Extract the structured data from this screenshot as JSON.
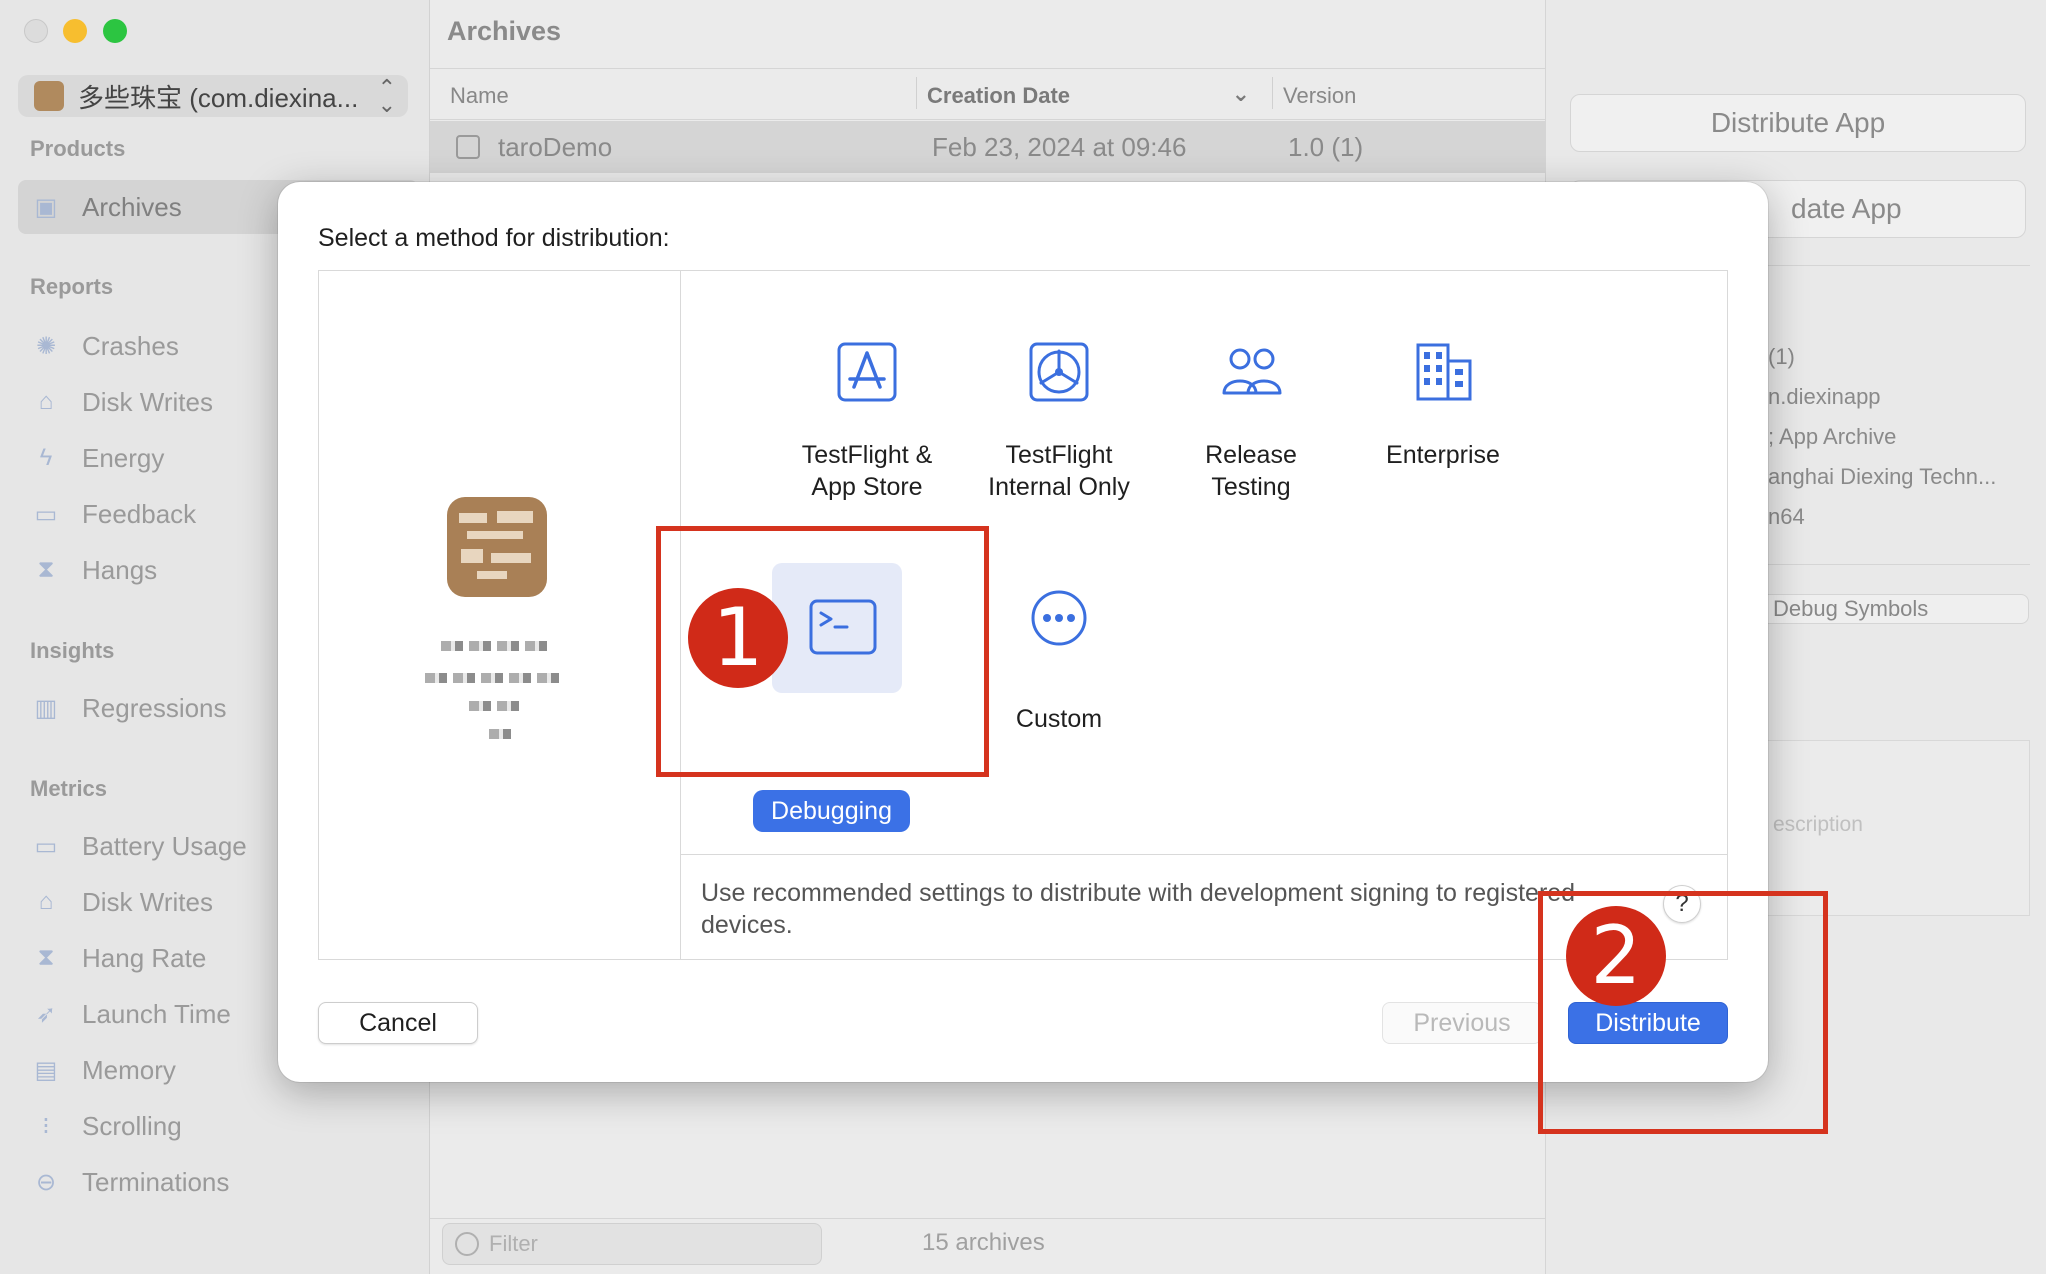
{
  "sidebar": {
    "app_selector": "多些珠宝 (com.diexina...",
    "sections": {
      "products": "Products",
      "reports": "Reports",
      "insights": "Insights",
      "metrics": "Metrics"
    },
    "products_items": [
      {
        "label": "Archives",
        "icon": "archive-icon"
      }
    ],
    "reports_items": [
      {
        "label": "Crashes",
        "icon": "crash-icon"
      },
      {
        "label": "Disk Writes",
        "icon": "disk-icon"
      },
      {
        "label": "Energy",
        "icon": "bolt-icon"
      },
      {
        "label": "Feedback",
        "icon": "speech-bubble-icon"
      },
      {
        "label": "Hangs",
        "icon": "hourglass-icon"
      }
    ],
    "insights_items": [
      {
        "label": "Regressions",
        "icon": "bar-chart-icon"
      }
    ],
    "metrics_items": [
      {
        "label": "Battery Usage",
        "icon": "battery-icon"
      },
      {
        "label": "Disk Writes",
        "icon": "disk-icon"
      },
      {
        "label": "Hang Rate",
        "icon": "hourglass-icon"
      },
      {
        "label": "Launch Time",
        "icon": "rocket-icon"
      },
      {
        "label": "Memory",
        "icon": "memory-icon"
      },
      {
        "label": "Scrolling",
        "icon": "scroll-icon"
      },
      {
        "label": "Terminations",
        "icon": "minus-circle-icon"
      }
    ]
  },
  "main": {
    "title": "Archives",
    "columns": {
      "name": "Name",
      "creation_date": "Creation Date",
      "version": "Version"
    },
    "selected_row": {
      "name": "taroDemo",
      "date": "Feb 23, 2024 at 09:46",
      "version": "1.0 (1)"
    },
    "filter_placeholder": "Filter",
    "archive_count": "15 archives"
  },
  "inspector": {
    "distribute_app": "Distribute App",
    "validate_app_partial": "date App",
    "info_lines": [
      "(1)",
      "n.diexinapp",
      "; App Archive",
      "anghai Diexing Techn...",
      "n64"
    ],
    "debug_symbols": "Debug Symbols",
    "description_placeholder": "escription"
  },
  "dialog": {
    "title": "Select a method for distribution:",
    "methods": [
      {
        "label": "TestFlight &\nApp Store",
        "icon": "app-store-icon"
      },
      {
        "label": "TestFlight\nInternal Only",
        "icon": "testflight-icon"
      },
      {
        "label": "Release\nTesting",
        "icon": "people-icon"
      },
      {
        "label": "Enterprise",
        "icon": "building-icon"
      },
      {
        "label": "Debugging",
        "icon": "terminal-icon",
        "selected": true
      },
      {
        "label": "Custom",
        "icon": "ellipsis-circle-icon"
      }
    ],
    "description": "Use recommended settings to distribute with development signing to registered devices.",
    "help": "?",
    "buttons": {
      "cancel": "Cancel",
      "previous": "Previous",
      "distribute": "Distribute"
    }
  },
  "annotations": {
    "step1": "1",
    "step2": "2"
  },
  "colors": {
    "accent": "#3b71e6",
    "icon_blue": "#3b6fdf",
    "annotation_red": "#d5331e"
  }
}
